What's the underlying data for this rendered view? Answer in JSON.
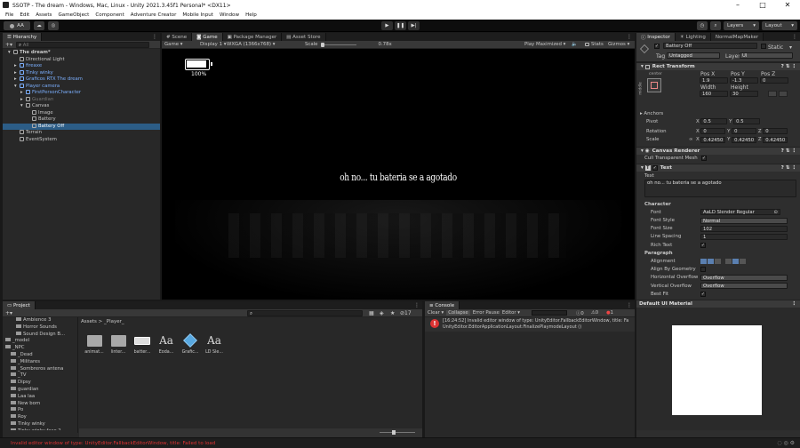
{
  "window": {
    "title": "SSOTP - The dream - Windows, Mac, Linux - Unity 2021.3.45f1 Personal* <DX11>",
    "controls": [
      "–",
      "□",
      "✕"
    ]
  },
  "menu": [
    "File",
    "Edit",
    "Assets",
    "GameObject",
    "Component",
    "Adventure Creator",
    "Mobile Input",
    "Window",
    "Help"
  ],
  "toolbar": {
    "account": "AA",
    "layers": "Layers",
    "layout": "Layout"
  },
  "hierarchy": {
    "tab": "Hierarchy",
    "search_placeholder": "All",
    "items": [
      {
        "label": "The dream*",
        "indent": 0,
        "cls": "",
        "arrow": "▾"
      },
      {
        "label": "Directional Light",
        "indent": 1,
        "cls": "",
        "arrow": ""
      },
      {
        "label": "fireaxe",
        "indent": 1,
        "cls": "blue",
        "arrow": "▸"
      },
      {
        "label": "Tinky winky",
        "indent": 1,
        "cls": "blue",
        "arrow": "▸"
      },
      {
        "label": "Graficos RTX The dream",
        "indent": 1,
        "cls": "blue",
        "arrow": "▸"
      },
      {
        "label": "Player camera",
        "indent": 1,
        "cls": "blue",
        "arrow": "▾"
      },
      {
        "label": "FirstPersonCharacter",
        "indent": 2,
        "cls": "blue",
        "arrow": "▸"
      },
      {
        "label": "Guardian",
        "indent": 2,
        "cls": "dim",
        "arrow": "▸"
      },
      {
        "label": "Canvas",
        "indent": 2,
        "cls": "",
        "arrow": "▾"
      },
      {
        "label": "Image",
        "indent": 3,
        "cls": "",
        "arrow": ""
      },
      {
        "label": "Battery",
        "indent": 3,
        "cls": "",
        "arrow": ""
      },
      {
        "label": "Battery Off",
        "indent": 3,
        "cls": "sel",
        "arrow": ""
      },
      {
        "label": "Terrain",
        "indent": 1,
        "cls": "",
        "arrow": ""
      },
      {
        "label": "EventSystem",
        "indent": 1,
        "cls": "",
        "arrow": ""
      }
    ]
  },
  "game_view": {
    "tabs": [
      "Scene",
      "Game",
      "Package Manager",
      "Asset Store"
    ],
    "display_mode": "Game",
    "display": "Display 1",
    "resolution": "WXGA (1366x768)",
    "scale_label": "Scale",
    "scale_value": "0.78x",
    "play_mode": "Play Maximized",
    "stats": "Stats",
    "gizmos": "Gizmos",
    "battery_label": "100%",
    "message": "oh no... tu bateria se a agotado"
  },
  "inspector": {
    "tabs": [
      "Inspector",
      "Lighting",
      "NormalMapMaker"
    ],
    "object_name": "Battery Off",
    "static_label": "Static",
    "tag_label": "Tag",
    "tag_value": "Untagged",
    "layer_label": "Layer",
    "layer_value": "UI",
    "rect_transform": {
      "title": "Rect Transform",
      "anchor_preset_label": "center",
      "anchor_side_label": "middle",
      "pos_x_label": "Pos X",
      "pos_y_label": "Pos Y",
      "pos_z_label": "Pos Z",
      "pos_x": "1.9",
      "pos_y": "-1.3",
      "pos_z": "0",
      "width_label": "Width",
      "height_label": "Height",
      "width": "160",
      "height": "30",
      "anchors_label": "Anchors",
      "pivot_label": "Pivot",
      "pivot_x": "0.5",
      "pivot_y": "0.5",
      "rotation_label": "Rotation",
      "rot_x": "0",
      "rot_y": "0",
      "rot_z": "0",
      "scale_label": "Scale",
      "scale_x": "0.42450",
      "scale_y": "0.42450",
      "scale_z": "0.42450"
    },
    "canvas_renderer": {
      "title": "Canvas Renderer",
      "cull_label": "Cull Transparent Mesh"
    },
    "text": {
      "title": "Text",
      "text_label": "Text",
      "text_value": "oh no... tu bateria se a agotado",
      "character_label": "Character",
      "font_label": "Font",
      "font_value": "LD Slender Regular",
      "font_style_label": "Font Style",
      "font_style_value": "Normal",
      "font_size_label": "Font Size",
      "font_size_value": "102",
      "line_spacing_label": "Line Spacing",
      "line_spacing_value": "1",
      "rich_text_label": "Rich Text",
      "paragraph_label": "Paragraph",
      "alignment_label": "Alignment",
      "align_geometry_label": "Align By Geometry",
      "h_overflow_label": "Horizontal Overflow",
      "h_overflow_value": "Overflow",
      "v_overflow_label": "Vertical Overflow",
      "v_overflow_value": "Overflow",
      "best_fit_label": "Best Fit"
    },
    "material": "Default UI Material"
  },
  "project": {
    "tab": "Project",
    "breadcrumb": "Assets > _Player_",
    "folder_count": "17",
    "tree": [
      {
        "label": "Ambience 3",
        "indent": 2,
        "folder": true
      },
      {
        "label": "Horror Sounds",
        "indent": 2,
        "folder": true
      },
      {
        "label": "Sound Design B...",
        "indent": 2,
        "folder": true
      },
      {
        "label": "_model",
        "indent": 0,
        "folder": true
      },
      {
        "label": "_NPC",
        "indent": 0,
        "folder": true
      },
      {
        "label": "_Dead",
        "indent": 1,
        "folder": true
      },
      {
        "label": "_Militares",
        "indent": 1,
        "folder": true
      },
      {
        "label": "_Sombreros antena",
        "indent": 1,
        "folder": true
      },
      {
        "label": "_TV",
        "indent": 1,
        "folder": true
      },
      {
        "label": "Dipsy",
        "indent": 1,
        "folder": true
      },
      {
        "label": "guardian",
        "indent": 1,
        "folder": true
      },
      {
        "label": "Laa laa",
        "indent": 1,
        "folder": true
      },
      {
        "label": "New born",
        "indent": 1,
        "folder": true
      },
      {
        "label": "Po",
        "indent": 1,
        "folder": true
      },
      {
        "label": "Roy",
        "indent": 1,
        "folder": true
      },
      {
        "label": "Tinky winky",
        "indent": 1,
        "folder": true
      },
      {
        "label": "Tinky winky fase 2",
        "indent": 1,
        "folder": true
      },
      {
        "label": "_Player_",
        "indent": 0,
        "folder": true
      }
    ],
    "assets": [
      {
        "name": "animat...",
        "kind": "folder"
      },
      {
        "name": "linter...",
        "kind": "folder"
      },
      {
        "name": "batter...",
        "kind": "battery"
      },
      {
        "name": "Eoda...",
        "kind": "font"
      },
      {
        "name": "Grafic...",
        "kind": "cube"
      },
      {
        "name": "LD Sle...",
        "kind": "font"
      }
    ]
  },
  "console": {
    "tab": "Console",
    "clear": "Clear",
    "collapse": "Collapse",
    "error_pause": "Error Pause",
    "editor": "Editor",
    "count_info": "0",
    "count_warn": "0",
    "count_error": "1",
    "entries": [
      {
        "line1": "[16:24:52] Invalid editor window of type: UnityEditor.FallbackEditorWindow, title: Fa",
        "line2": "UnityEditor.EditorApplicationLayout:FinalizePlaymodeLayout ()"
      }
    ]
  },
  "status": {
    "message": "Invalid editor window of type: UnityEditor.FallbackEditorWindow, title: Failed to load"
  },
  "colors": {
    "selection": "#2c5d87",
    "blue_text": "#7cb0ff",
    "error": "#d33333"
  }
}
